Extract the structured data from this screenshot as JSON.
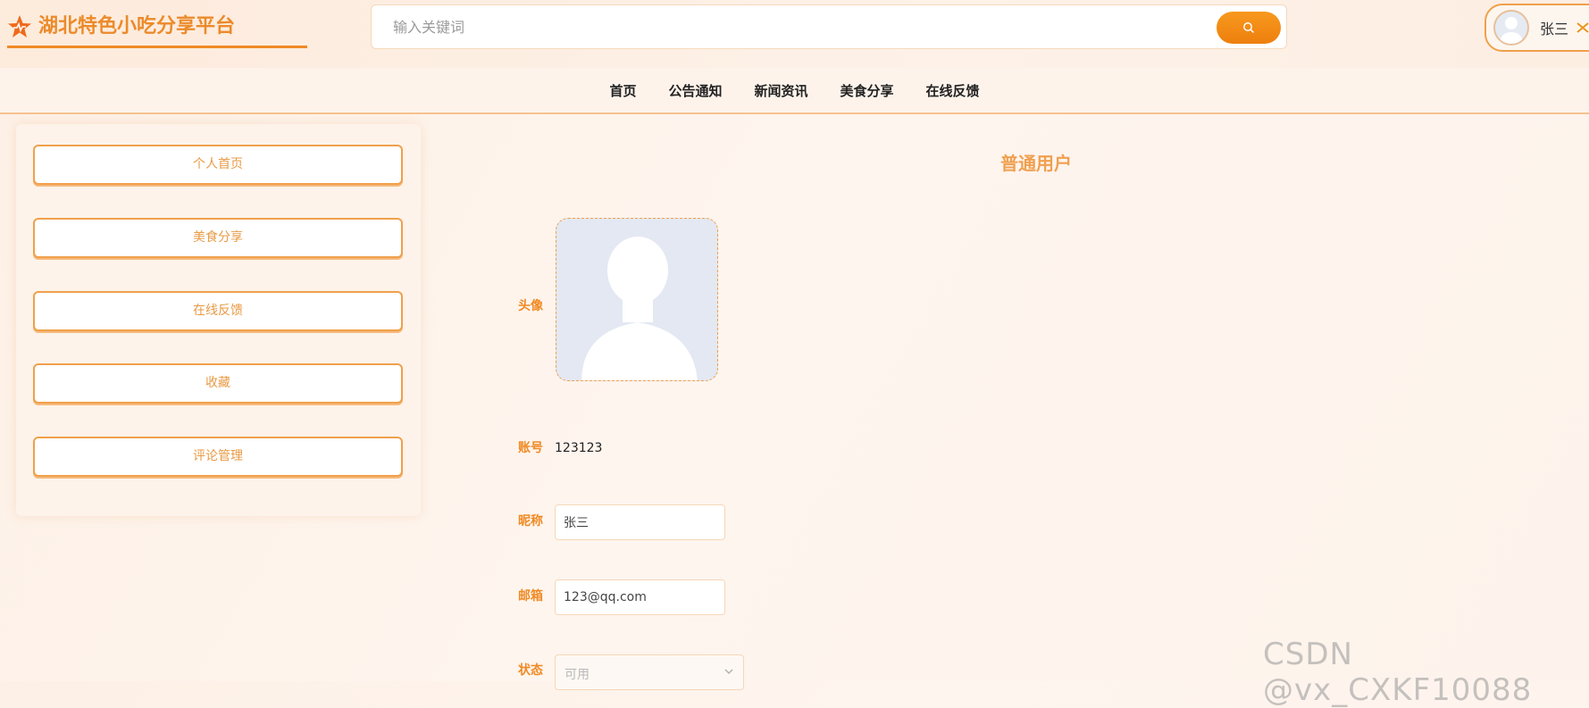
{
  "header": {
    "site_title": "湖北特色小吃分享平台",
    "search_placeholder": "输入关键词",
    "username": "张三"
  },
  "nav": {
    "items": [
      "首页",
      "公告通知",
      "新闻资讯",
      "美食分享",
      "在线反馈"
    ]
  },
  "sidebar": {
    "items": [
      "个人首页",
      "美食分享",
      "在线反馈",
      "收藏",
      "评论管理"
    ]
  },
  "profile": {
    "role_title": "普通用户",
    "avatar_label": "头像",
    "account_label": "账号",
    "account_value": "123123",
    "nickname_label": "昵称",
    "nickname_value": "张三",
    "email_label": "邮箱",
    "email_value": "123@qq.com",
    "status_label": "状态",
    "status_value": "可用"
  },
  "watermark": "CSDN @vx_CXKF10088",
  "colors": {
    "accent": "#f08a24",
    "accent_light": "#f0a04b",
    "avatar_bg": "#e3e8f2"
  }
}
